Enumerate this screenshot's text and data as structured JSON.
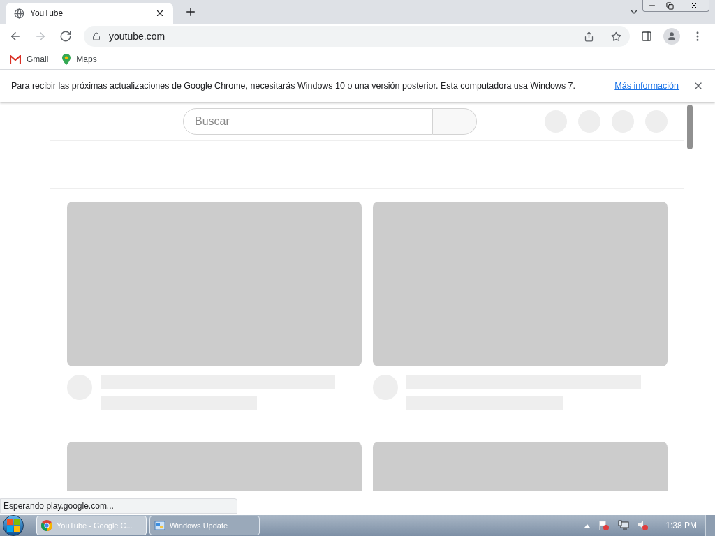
{
  "tabs": [
    {
      "title": "YouTube",
      "selected": true
    }
  ],
  "nav_buttons": [
    {
      "kind": "back",
      "disabled": false
    },
    {
      "kind": "forward",
      "disabled": true
    },
    {
      "kind": "reload",
      "disabled": false
    }
  ],
  "address": {
    "value": "youtube.com"
  },
  "bookmarks": [
    {
      "kind": "gmail",
      "label": "Gmail"
    },
    {
      "kind": "maps",
      "label": "Maps"
    }
  ],
  "infobar": {
    "message": "Para recibir las próximas actualizaciones de Google Chrome, necesitarás Windows 10 o una versión posterior. Esta computadora usa Windows 7.",
    "link": "Más información"
  },
  "page": {
    "search": {
      "placeholder": "Buscar"
    },
    "feed": [
      {
        "kind": "skeleton"
      },
      {
        "kind": "skeleton"
      },
      {
        "kind": "thumbnail_only"
      },
      {
        "kind": "thumbnail_only"
      }
    ]
  },
  "status_bubble": "Esperando play.google.com...",
  "taskbar": {
    "buttons": [
      {
        "kind": "chrome",
        "label": "YouTube - Google C...",
        "selected": true
      },
      {
        "kind": "update",
        "label": "Windows Update",
        "selected": false
      }
    ],
    "clock": "1:38 PM"
  }
}
